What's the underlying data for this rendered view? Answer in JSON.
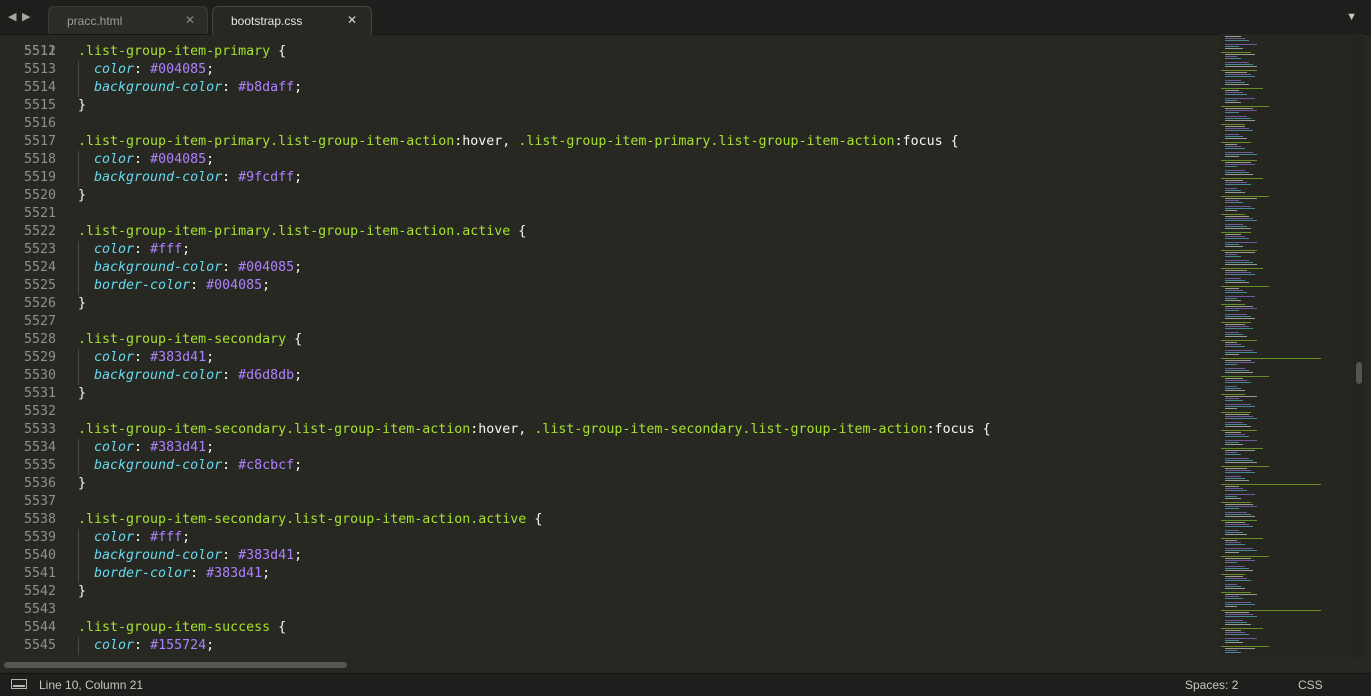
{
  "tabs": [
    {
      "label": "pracc.html",
      "active": false
    },
    {
      "label": "bootstrap.css",
      "active": true
    }
  ],
  "icons": {
    "back": "left-arrow-icon",
    "forward": "right-arrow-icon",
    "close": "close-icon",
    "tab_menu": "chevron-down-icon",
    "panel": "panel-toggle-icon"
  },
  "editor": {
    "partial_line_number": "5511",
    "lines": [
      {
        "num": "5512",
        "tokens": [
          {
            "t": ".list-group-item-primary",
            "c": "sel"
          },
          {
            "t": " {",
            "c": "punc"
          }
        ]
      },
      {
        "num": "5513",
        "tokens": [
          {
            "t": "  ",
            "c": "plain"
          },
          {
            "t": "color",
            "c": "prop"
          },
          {
            "t": ": ",
            "c": "punc"
          },
          {
            "t": "#004085",
            "c": "val"
          },
          {
            "t": ";",
            "c": "punc"
          }
        ]
      },
      {
        "num": "5514",
        "tokens": [
          {
            "t": "  ",
            "c": "plain"
          },
          {
            "t": "background-color",
            "c": "prop"
          },
          {
            "t": ": ",
            "c": "punc"
          },
          {
            "t": "#b8daff",
            "c": "val"
          },
          {
            "t": ";",
            "c": "punc"
          }
        ]
      },
      {
        "num": "5515",
        "tokens": [
          {
            "t": "}",
            "c": "punc"
          }
        ]
      },
      {
        "num": "5516",
        "tokens": []
      },
      {
        "num": "5517",
        "tokens": [
          {
            "t": ".list-group-item-primary.list-group-item-action",
            "c": "sel"
          },
          {
            "t": ":hover, ",
            "c": "plain"
          },
          {
            "t": ".list-group-item-primary.list-group-item-action",
            "c": "sel"
          },
          {
            "t": ":focus {",
            "c": "plain"
          }
        ]
      },
      {
        "num": "5518",
        "tokens": [
          {
            "t": "  ",
            "c": "plain"
          },
          {
            "t": "color",
            "c": "prop"
          },
          {
            "t": ": ",
            "c": "punc"
          },
          {
            "t": "#004085",
            "c": "val"
          },
          {
            "t": ";",
            "c": "punc"
          }
        ]
      },
      {
        "num": "5519",
        "tokens": [
          {
            "t": "  ",
            "c": "plain"
          },
          {
            "t": "background-color",
            "c": "prop"
          },
          {
            "t": ": ",
            "c": "punc"
          },
          {
            "t": "#9fcdff",
            "c": "val"
          },
          {
            "t": ";",
            "c": "punc"
          }
        ]
      },
      {
        "num": "5520",
        "tokens": [
          {
            "t": "}",
            "c": "punc"
          }
        ]
      },
      {
        "num": "5521",
        "tokens": []
      },
      {
        "num": "5522",
        "tokens": [
          {
            "t": ".list-group-item-primary.list-group-item-action.active",
            "c": "sel"
          },
          {
            "t": " {",
            "c": "punc"
          }
        ]
      },
      {
        "num": "5523",
        "tokens": [
          {
            "t": "  ",
            "c": "plain"
          },
          {
            "t": "color",
            "c": "prop"
          },
          {
            "t": ": ",
            "c": "punc"
          },
          {
            "t": "#fff",
            "c": "val"
          },
          {
            "t": ";",
            "c": "punc"
          }
        ]
      },
      {
        "num": "5524",
        "tokens": [
          {
            "t": "  ",
            "c": "plain"
          },
          {
            "t": "background-color",
            "c": "prop"
          },
          {
            "t": ": ",
            "c": "punc"
          },
          {
            "t": "#004085",
            "c": "val"
          },
          {
            "t": ";",
            "c": "punc"
          }
        ]
      },
      {
        "num": "5525",
        "tokens": [
          {
            "t": "  ",
            "c": "plain"
          },
          {
            "t": "border-color",
            "c": "prop"
          },
          {
            "t": ": ",
            "c": "punc"
          },
          {
            "t": "#004085",
            "c": "val"
          },
          {
            "t": ";",
            "c": "punc"
          }
        ]
      },
      {
        "num": "5526",
        "tokens": [
          {
            "t": "}",
            "c": "punc"
          }
        ]
      },
      {
        "num": "5527",
        "tokens": []
      },
      {
        "num": "5528",
        "tokens": [
          {
            "t": ".list-group-item-secondary",
            "c": "sel"
          },
          {
            "t": " {",
            "c": "punc"
          }
        ]
      },
      {
        "num": "5529",
        "tokens": [
          {
            "t": "  ",
            "c": "plain"
          },
          {
            "t": "color",
            "c": "prop"
          },
          {
            "t": ": ",
            "c": "punc"
          },
          {
            "t": "#383d41",
            "c": "val"
          },
          {
            "t": ";",
            "c": "punc"
          }
        ]
      },
      {
        "num": "5530",
        "tokens": [
          {
            "t": "  ",
            "c": "plain"
          },
          {
            "t": "background-color",
            "c": "prop"
          },
          {
            "t": ": ",
            "c": "punc"
          },
          {
            "t": "#d6d8db",
            "c": "val"
          },
          {
            "t": ";",
            "c": "punc"
          }
        ]
      },
      {
        "num": "5531",
        "tokens": [
          {
            "t": "}",
            "c": "punc"
          }
        ]
      },
      {
        "num": "5532",
        "tokens": []
      },
      {
        "num": "5533",
        "tokens": [
          {
            "t": ".list-group-item-secondary.list-group-item-action",
            "c": "sel"
          },
          {
            "t": ":hover, ",
            "c": "plain"
          },
          {
            "t": ".list-group-item-secondary.list-group-item-action",
            "c": "sel"
          },
          {
            "t": ":focus {",
            "c": "plain"
          }
        ]
      },
      {
        "num": "5534",
        "tokens": [
          {
            "t": "  ",
            "c": "plain"
          },
          {
            "t": "color",
            "c": "prop"
          },
          {
            "t": ": ",
            "c": "punc"
          },
          {
            "t": "#383d41",
            "c": "val"
          },
          {
            "t": ";",
            "c": "punc"
          }
        ]
      },
      {
        "num": "5535",
        "tokens": [
          {
            "t": "  ",
            "c": "plain"
          },
          {
            "t": "background-color",
            "c": "prop"
          },
          {
            "t": ": ",
            "c": "punc"
          },
          {
            "t": "#c8cbcf",
            "c": "val"
          },
          {
            "t": ";",
            "c": "punc"
          }
        ]
      },
      {
        "num": "5536",
        "tokens": [
          {
            "t": "}",
            "c": "punc"
          }
        ]
      },
      {
        "num": "5537",
        "tokens": []
      },
      {
        "num": "5538",
        "tokens": [
          {
            "t": ".list-group-item-secondary.list-group-item-action.active",
            "c": "sel"
          },
          {
            "t": " {",
            "c": "punc"
          }
        ]
      },
      {
        "num": "5539",
        "tokens": [
          {
            "t": "  ",
            "c": "plain"
          },
          {
            "t": "color",
            "c": "prop"
          },
          {
            "t": ": ",
            "c": "punc"
          },
          {
            "t": "#fff",
            "c": "val"
          },
          {
            "t": ";",
            "c": "punc"
          }
        ]
      },
      {
        "num": "5540",
        "tokens": [
          {
            "t": "  ",
            "c": "plain"
          },
          {
            "t": "background-color",
            "c": "prop"
          },
          {
            "t": ": ",
            "c": "punc"
          },
          {
            "t": "#383d41",
            "c": "val"
          },
          {
            "t": ";",
            "c": "punc"
          }
        ]
      },
      {
        "num": "5541",
        "tokens": [
          {
            "t": "  ",
            "c": "plain"
          },
          {
            "t": "border-color",
            "c": "prop"
          },
          {
            "t": ": ",
            "c": "punc"
          },
          {
            "t": "#383d41",
            "c": "val"
          },
          {
            "t": ";",
            "c": "punc"
          }
        ]
      },
      {
        "num": "5542",
        "tokens": [
          {
            "t": "}",
            "c": "punc"
          }
        ]
      },
      {
        "num": "5543",
        "tokens": []
      },
      {
        "num": "5544",
        "tokens": [
          {
            "t": ".list-group-item-success",
            "c": "sel"
          },
          {
            "t": " {",
            "c": "punc"
          }
        ]
      },
      {
        "num": "5545",
        "tokens": [
          {
            "t": "  ",
            "c": "plain"
          },
          {
            "t": "color",
            "c": "prop"
          },
          {
            "t": ": ",
            "c": "punc"
          },
          {
            "t": "#155724",
            "c": "val"
          },
          {
            "t": ";",
            "c": "punc"
          }
        ]
      }
    ]
  },
  "status": {
    "position": "Line 10, Column 21",
    "indentation": "Spaces: 2",
    "syntax": "CSS"
  },
  "colors": {
    "background": "#272822",
    "selector": "#a6e22e",
    "property": "#66d9ef",
    "value": "#ae81ff",
    "text": "#f8f8f2",
    "line_number": "#90908a",
    "chrome": "#1e1f1c"
  }
}
